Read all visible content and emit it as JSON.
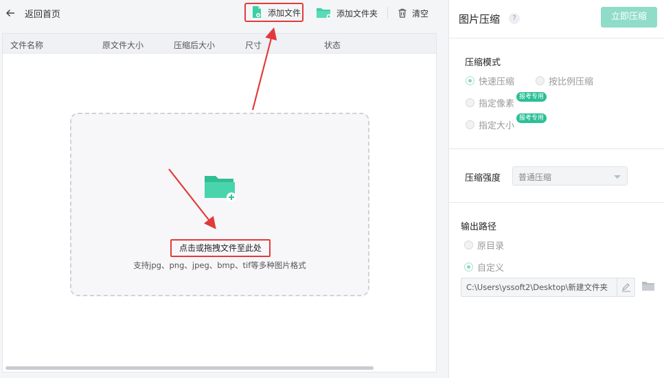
{
  "toolbar": {
    "back_label": "返回首页",
    "add_file_label": "添加文件",
    "add_folder_label": "添加文件夹",
    "clear_label": "清空"
  },
  "table": {
    "columns": [
      "文件名称",
      "原文件大小",
      "压缩后大小",
      "尺寸",
      "状态"
    ]
  },
  "dropzone": {
    "main_text": "点击或拖拽文件至此处",
    "sub_text": "支持jpg、png、jpeg、bmp、tif等多种图片格式"
  },
  "panel": {
    "title": "图片压缩",
    "help": "?",
    "compress_button": "立即压缩",
    "mode": {
      "label": "压缩模式",
      "options": [
        "快速压缩",
        "按比例压缩",
        "指定像素",
        "指定大小"
      ],
      "selected": "快速压缩",
      "badge": "报考专用"
    },
    "strength": {
      "label": "压缩强度",
      "value": "普通压缩"
    },
    "output": {
      "label": "输出路径",
      "options": [
        "原目录",
        "自定义"
      ],
      "selected": "自定义",
      "path": "C:\\Users\\yssoft2\\Desktop\\新建文件夹"
    }
  },
  "colors": {
    "accent": "#2bbf96",
    "highlight": "#e23a3a",
    "compress_button": "#8fdcc8"
  }
}
